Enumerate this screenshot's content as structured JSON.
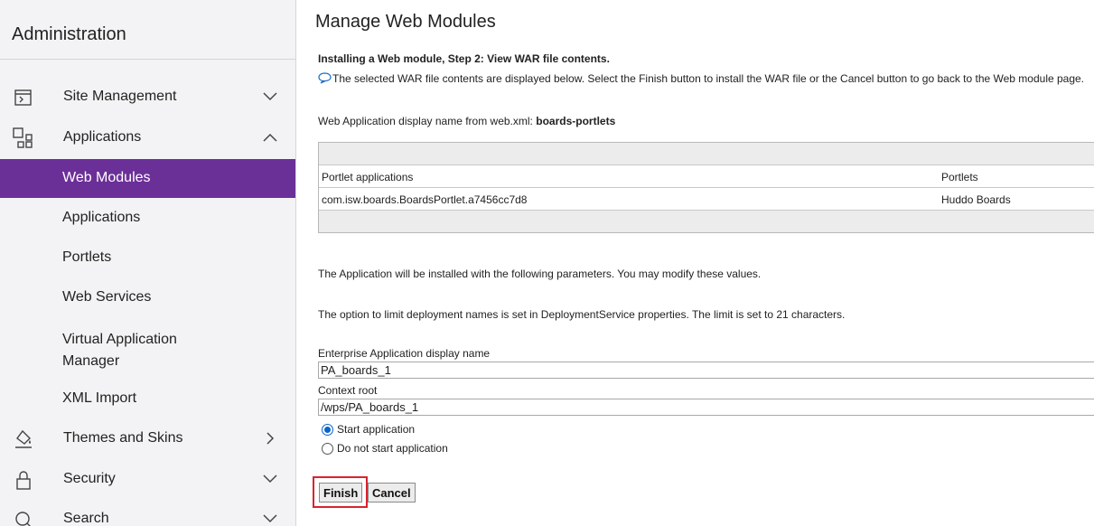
{
  "sidebar": {
    "title": "Administration",
    "items": [
      {
        "label": "Site Management"
      },
      {
        "label": "Applications"
      },
      {
        "label": "Themes and Skins"
      },
      {
        "label": "Security"
      },
      {
        "label": "Search"
      }
    ],
    "sub_items": [
      {
        "label": "Web Modules"
      },
      {
        "label": "Applications"
      },
      {
        "label": "Portlets"
      },
      {
        "label": "Web Services"
      },
      {
        "label": "Virtual Application Manager"
      },
      {
        "label": "XML Import"
      }
    ],
    "active_color": "#6b2f98"
  },
  "main": {
    "title": "Manage Web Modules",
    "step_title": "Installing a Web module, Step 2: View WAR file contents.",
    "info_text": "The selected WAR file contents are displayed below. Select the Finish button to install the WAR file or the Cancel button to go back to the Web module page.",
    "display_name_label": "Web Application display name from web.xml:",
    "display_name_value": "boards-portlets",
    "table": {
      "columns": [
        "Portlet applications",
        "Portlets"
      ],
      "rows": [
        [
          "com.isw.boards.BoardsPortlet.a7456cc7d8",
          "Huddo Boards"
        ]
      ]
    },
    "params_text": "The Application will be installed with the following parameters. You may modify these values.",
    "limit_text": "The option to limit deployment names is set in DeploymentService properties. The limit is set to 21 characters.",
    "enterprise_label": "Enterprise Application display name",
    "enterprise_value": "PA_boards_1",
    "context_label": "Context root",
    "context_value": "/wps/PA_boards_1",
    "radio_start": "Start application",
    "radio_nostart": "Do not start application",
    "finish_label": "Finish",
    "cancel_label": "Cancel",
    "highlight_color": "#d9232e"
  }
}
